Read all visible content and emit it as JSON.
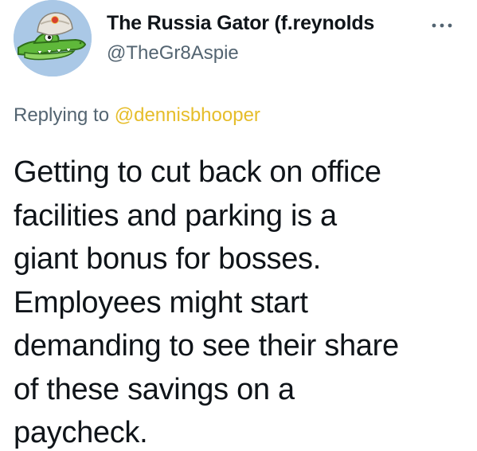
{
  "author": {
    "display_name": "The Russia Gator (f.reynolds",
    "handle": "@TheGr8Aspie"
  },
  "reply": {
    "prefix": "Replying to",
    "to_user": "@dennisbhooper"
  },
  "tweet": {
    "lines": [
      "Getting to cut back on office",
      "facilities and parking is a",
      "giant bonus for bosses.",
      "Employees might start",
      "demanding to see their share",
      "of these savings on a",
      "paycheck."
    ]
  },
  "icons": {
    "more": "more-icon",
    "avatar": "gator-avatar"
  },
  "colors": {
    "text": "#0f1419",
    "secondary": "#536471",
    "mention": "#e6bd2a",
    "avatar_bg": "#aac8e6"
  }
}
